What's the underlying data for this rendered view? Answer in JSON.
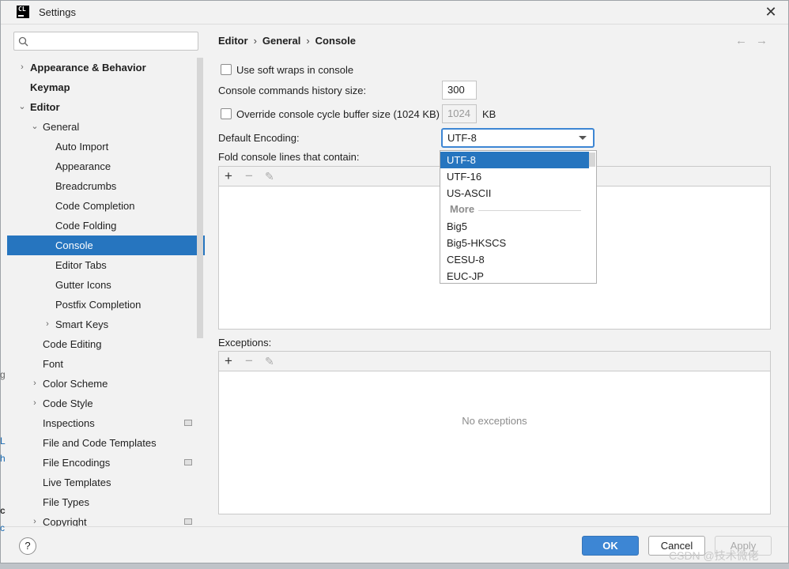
{
  "window": {
    "title": "Settings",
    "app_icon_text": "CL",
    "close_glyph": "✕"
  },
  "sidebar": {
    "search_placeholder": "",
    "items": [
      {
        "label": "Appearance & Behavior",
        "bold": true,
        "level": 0,
        "arrow": "›"
      },
      {
        "label": "Keymap",
        "bold": true,
        "level": 0,
        "arrow": ""
      },
      {
        "label": "Editor",
        "bold": true,
        "level": 0,
        "arrow": "⌄"
      },
      {
        "label": "General",
        "bold": false,
        "level": 1,
        "arrow": "⌄"
      },
      {
        "label": "Auto Import",
        "bold": false,
        "level": 2,
        "arrow": ""
      },
      {
        "label": "Appearance",
        "bold": false,
        "level": 2,
        "arrow": ""
      },
      {
        "label": "Breadcrumbs",
        "bold": false,
        "level": 2,
        "arrow": ""
      },
      {
        "label": "Code Completion",
        "bold": false,
        "level": 2,
        "arrow": ""
      },
      {
        "label": "Code Folding",
        "bold": false,
        "level": 2,
        "arrow": ""
      },
      {
        "label": "Console",
        "bold": false,
        "level": 2,
        "arrow": "",
        "selected": true
      },
      {
        "label": "Editor Tabs",
        "bold": false,
        "level": 2,
        "arrow": ""
      },
      {
        "label": "Gutter Icons",
        "bold": false,
        "level": 2,
        "arrow": ""
      },
      {
        "label": "Postfix Completion",
        "bold": false,
        "level": 2,
        "arrow": ""
      },
      {
        "label": "Smart Keys",
        "bold": false,
        "level": 2,
        "arrow": "›"
      },
      {
        "label": "Code Editing",
        "bold": false,
        "level": 1,
        "arrow": ""
      },
      {
        "label": "Font",
        "bold": false,
        "level": 1,
        "arrow": ""
      },
      {
        "label": "Color Scheme",
        "bold": false,
        "level": 1,
        "arrow": "›"
      },
      {
        "label": "Code Style",
        "bold": false,
        "level": 1,
        "arrow": "›"
      },
      {
        "label": "Inspections",
        "bold": false,
        "level": 1,
        "arrow": "",
        "icon": true
      },
      {
        "label": "File and Code Templates",
        "bold": false,
        "level": 1,
        "arrow": ""
      },
      {
        "label": "File Encodings",
        "bold": false,
        "level": 1,
        "arrow": "",
        "icon": true
      },
      {
        "label": "Live Templates",
        "bold": false,
        "level": 1,
        "arrow": ""
      },
      {
        "label": "File Types",
        "bold": false,
        "level": 1,
        "arrow": ""
      },
      {
        "label": "Copyright",
        "bold": false,
        "level": 1,
        "arrow": "›",
        "icon": true
      }
    ]
  },
  "breadcrumb": {
    "items": [
      "Editor",
      "General",
      "Console"
    ],
    "separator": "›",
    "back_glyph": "←",
    "forward_glyph": "→"
  },
  "console": {
    "soft_wraps_label": "Use soft wraps in console",
    "history_label": "Console commands history size:",
    "history_value": "300",
    "override_label": "Override console cycle buffer size (1024 KB)",
    "buffer_value": "1024",
    "buffer_unit": "KB",
    "encoding_label": "Default Encoding:",
    "encoding_value": "UTF-8",
    "fold_label": "Fold console lines that contain:",
    "exceptions_label": "Exceptions:",
    "no_exceptions": "No exceptions",
    "toolbar": {
      "add": "+",
      "remove": "−",
      "edit": "✎"
    }
  },
  "encoding_popup": {
    "options": [
      "UTF-8",
      "UTF-16",
      "US-ASCII"
    ],
    "more_label": "More",
    "more_options": [
      "Big5",
      "Big5-HKSCS",
      "CESU-8",
      "EUC-JP"
    ]
  },
  "footer": {
    "help": "?",
    "ok": "OK",
    "cancel": "Cancel",
    "apply": "Apply"
  },
  "left_edge": {
    "a": "g",
    "b": "L",
    "c": "h",
    "d": "c",
    "e": "c"
  },
  "watermark": "CSDN @技术微佬",
  "colors": {
    "selection": "#2675bf",
    "accent": "#3d86d4"
  }
}
